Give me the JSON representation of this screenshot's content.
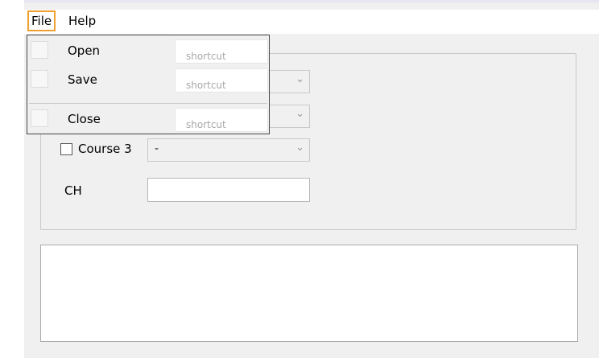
{
  "menubar": {
    "file": "File",
    "help": "Help"
  },
  "file_menu": {
    "items": [
      {
        "label": "Open",
        "shortcut": "shortcut"
      },
      {
        "label": "Save",
        "shortcut": "shortcut"
      },
      {
        "label": "Close",
        "shortcut": "shortcut"
      }
    ]
  },
  "form": {
    "course3_label": "Course 3",
    "course3_value": "-",
    "ch_label": "CH",
    "ch_value": ""
  }
}
